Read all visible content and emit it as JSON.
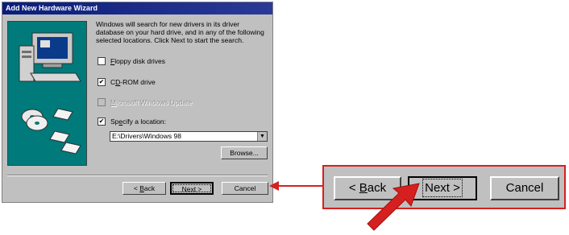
{
  "window": {
    "title": "Add New Hardware Wizard"
  },
  "intro_text": "Windows will search for new drivers in its driver database on your hard drive, and in any of the following selected locations. Click Next to start the search.",
  "options": [
    {
      "hotkey": "F",
      "rest": "loppy disk drives",
      "checked": false,
      "enabled": true
    },
    {
      "prefix": "C",
      "hotkey": "D",
      "rest": "-ROM drive",
      "checked": true,
      "enabled": true
    },
    {
      "hotkey": "M",
      "rest": "icrosoft Windows Update",
      "checked": false,
      "enabled": false
    },
    {
      "prefix": "Sp",
      "hotkey": "e",
      "rest": "cify a location:",
      "checked": true,
      "enabled": true
    }
  ],
  "location_value": "E:\\Drivers\\Windows 98",
  "buttons": {
    "browse": "Browse...",
    "back_arrow": "< ",
    "back_hotkey": "B",
    "back_rest": "ack",
    "next": "Next >",
    "cancel": "Cancel"
  },
  "check_mark": "✔",
  "dropdown_arrow": "▼",
  "colors": {
    "highlight_red": "#d62020",
    "titlebar": "#0a1d7a",
    "art_bg": "#007a7a"
  }
}
